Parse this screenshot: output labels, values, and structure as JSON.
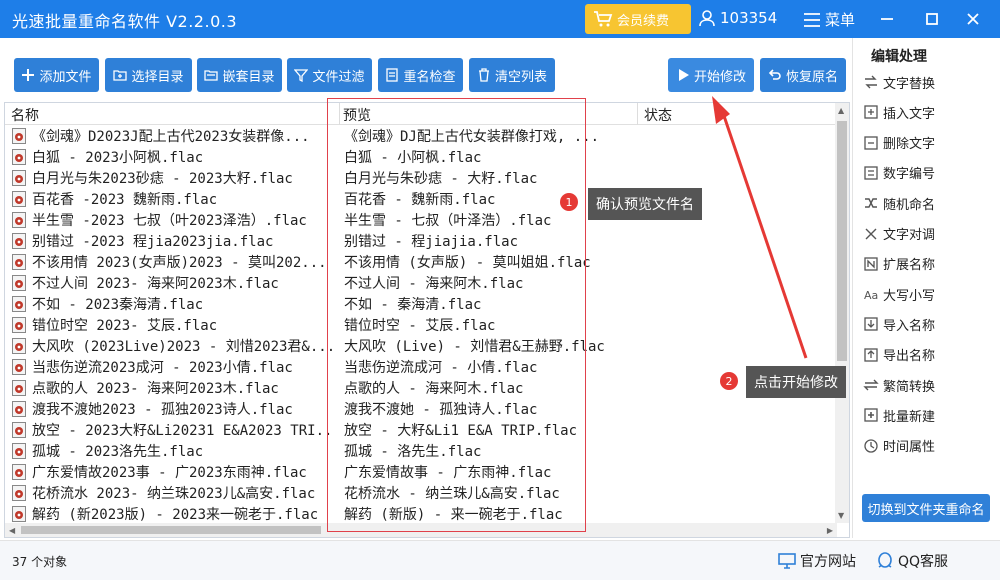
{
  "app": {
    "title": "光速批量重命名软件 V2.2.0.3",
    "vip_label": "会员续费",
    "user_id": "103354",
    "menu_label": "菜单"
  },
  "toolbar": {
    "add_file": "添加文件",
    "select_dir": "选择目录",
    "nested_dir": "嵌套目录",
    "file_filter": "文件过滤",
    "dup_check": "重名检查",
    "clear_list": "清空列表",
    "start_modify": "开始修改",
    "restore": "恢复原名"
  },
  "list": {
    "headers": {
      "name": "名称",
      "preview": "预览",
      "status": "状态"
    },
    "rows": [
      {
        "name": "《剑魂》D2023J配上古代2023女装群像...",
        "preview": "《剑魂》DJ配上古代女装群像打戏, ..."
      },
      {
        "name": "白狐 - 2023小阿枫.flac",
        "preview": "白狐 - 小阿枫.flac"
      },
      {
        "name": "白月光与朱2023砂痣 - 2023大籽.flac",
        "preview": "白月光与朱砂痣 - 大籽.flac"
      },
      {
        "name": "百花香 -2023 魏新雨.flac",
        "preview": "百花香 - 魏新雨.flac"
      },
      {
        "name": "半生雪 -2023 七叔（叶2023泽浩）.flac",
        "preview": "半生雪 - 七叔（叶泽浩）.flac"
      },
      {
        "name": "别错过 -2023 程jia2023jia.flac",
        "preview": "别错过 - 程jiajia.flac"
      },
      {
        "name": "不该用情 2023(女声版)2023 - 莫叫202...",
        "preview": "不该用情 (女声版) - 莫叫姐姐.flac"
      },
      {
        "name": "不过人间 2023- 海来阿2023木.flac",
        "preview": "不过人间 - 海来阿木.flac"
      },
      {
        "name": "不如 - 2023秦海清.flac",
        "preview": "不如 - 秦海清.flac"
      },
      {
        "name": "错位时空 2023- 艾辰.flac",
        "preview": "错位时空 - 艾辰.flac"
      },
      {
        "name": "大风吹 (2023Live)2023 - 刘惜2023君&...",
        "preview": "大风吹 (Live) - 刘惜君&王赫野.flac"
      },
      {
        "name": "当悲伤逆流2023成河 - 2023小倩.flac",
        "preview": "当悲伤逆流成河 - 小倩.flac"
      },
      {
        "name": "点歌的人 2023- 海来阿2023木.flac",
        "preview": "点歌的人 - 海来阿木.flac"
      },
      {
        "name": "渡我不渡她2023 - 孤独2023诗人.flac",
        "preview": "渡我不渡她 - 孤独诗人.flac"
      },
      {
        "name": "放空 - 2023大籽&Li20231 E&A2023 TRI...",
        "preview": "放空 - 大籽&Li1 E&A TRIP.flac"
      },
      {
        "name": "孤城 - 2023洛先生.flac",
        "preview": "孤城 - 洛先生.flac"
      },
      {
        "name": "广东爱情故2023事 - 广2023东雨神.flac",
        "preview": "广东爱情故事 - 广东雨神.flac"
      },
      {
        "name": "花桥流水 2023- 纳兰珠2023儿&高安.flac",
        "preview": "花桥流水 - 纳兰珠儿&高安.flac"
      },
      {
        "name": "解药 (新2023版) - 2023来一碗老于.flac",
        "preview": "解药 (新版) - 来一碗老于.flac"
      }
    ]
  },
  "callouts": {
    "step1_num": "1",
    "step1_text": "确认预览文件名",
    "step2_num": "2",
    "step2_text": "点击开始修改"
  },
  "side": {
    "title": "编辑处理",
    "items": [
      {
        "label": "文字替换",
        "icon": "replace-icon"
      },
      {
        "label": "插入文字",
        "icon": "insert-icon"
      },
      {
        "label": "删除文字",
        "icon": "delete-text-icon"
      },
      {
        "label": "数字编号",
        "icon": "number-icon"
      },
      {
        "label": "随机命名",
        "icon": "shuffle-icon"
      },
      {
        "label": "文字对调",
        "icon": "swap-icon"
      },
      {
        "label": "扩展名称",
        "icon": "extension-icon"
      },
      {
        "label": "大写小写",
        "icon": "case-icon"
      },
      {
        "label": "导入名称",
        "icon": "import-icon"
      },
      {
        "label": "导出名称",
        "icon": "export-icon"
      },
      {
        "label": "繁简转换",
        "icon": "convert-icon"
      },
      {
        "label": "批量新建",
        "icon": "batch-new-icon"
      },
      {
        "label": "时间属性",
        "icon": "clock-icon"
      }
    ],
    "switch_label": "切换到文件夹重命名"
  },
  "status": {
    "count": "37 个对象",
    "website": "官方网站",
    "qq": "QQ客服"
  },
  "colors": {
    "titlebar": "#1e7ee8",
    "button": "#2f80d8",
    "vip": "#f7c531",
    "highlight": "#e53935"
  }
}
